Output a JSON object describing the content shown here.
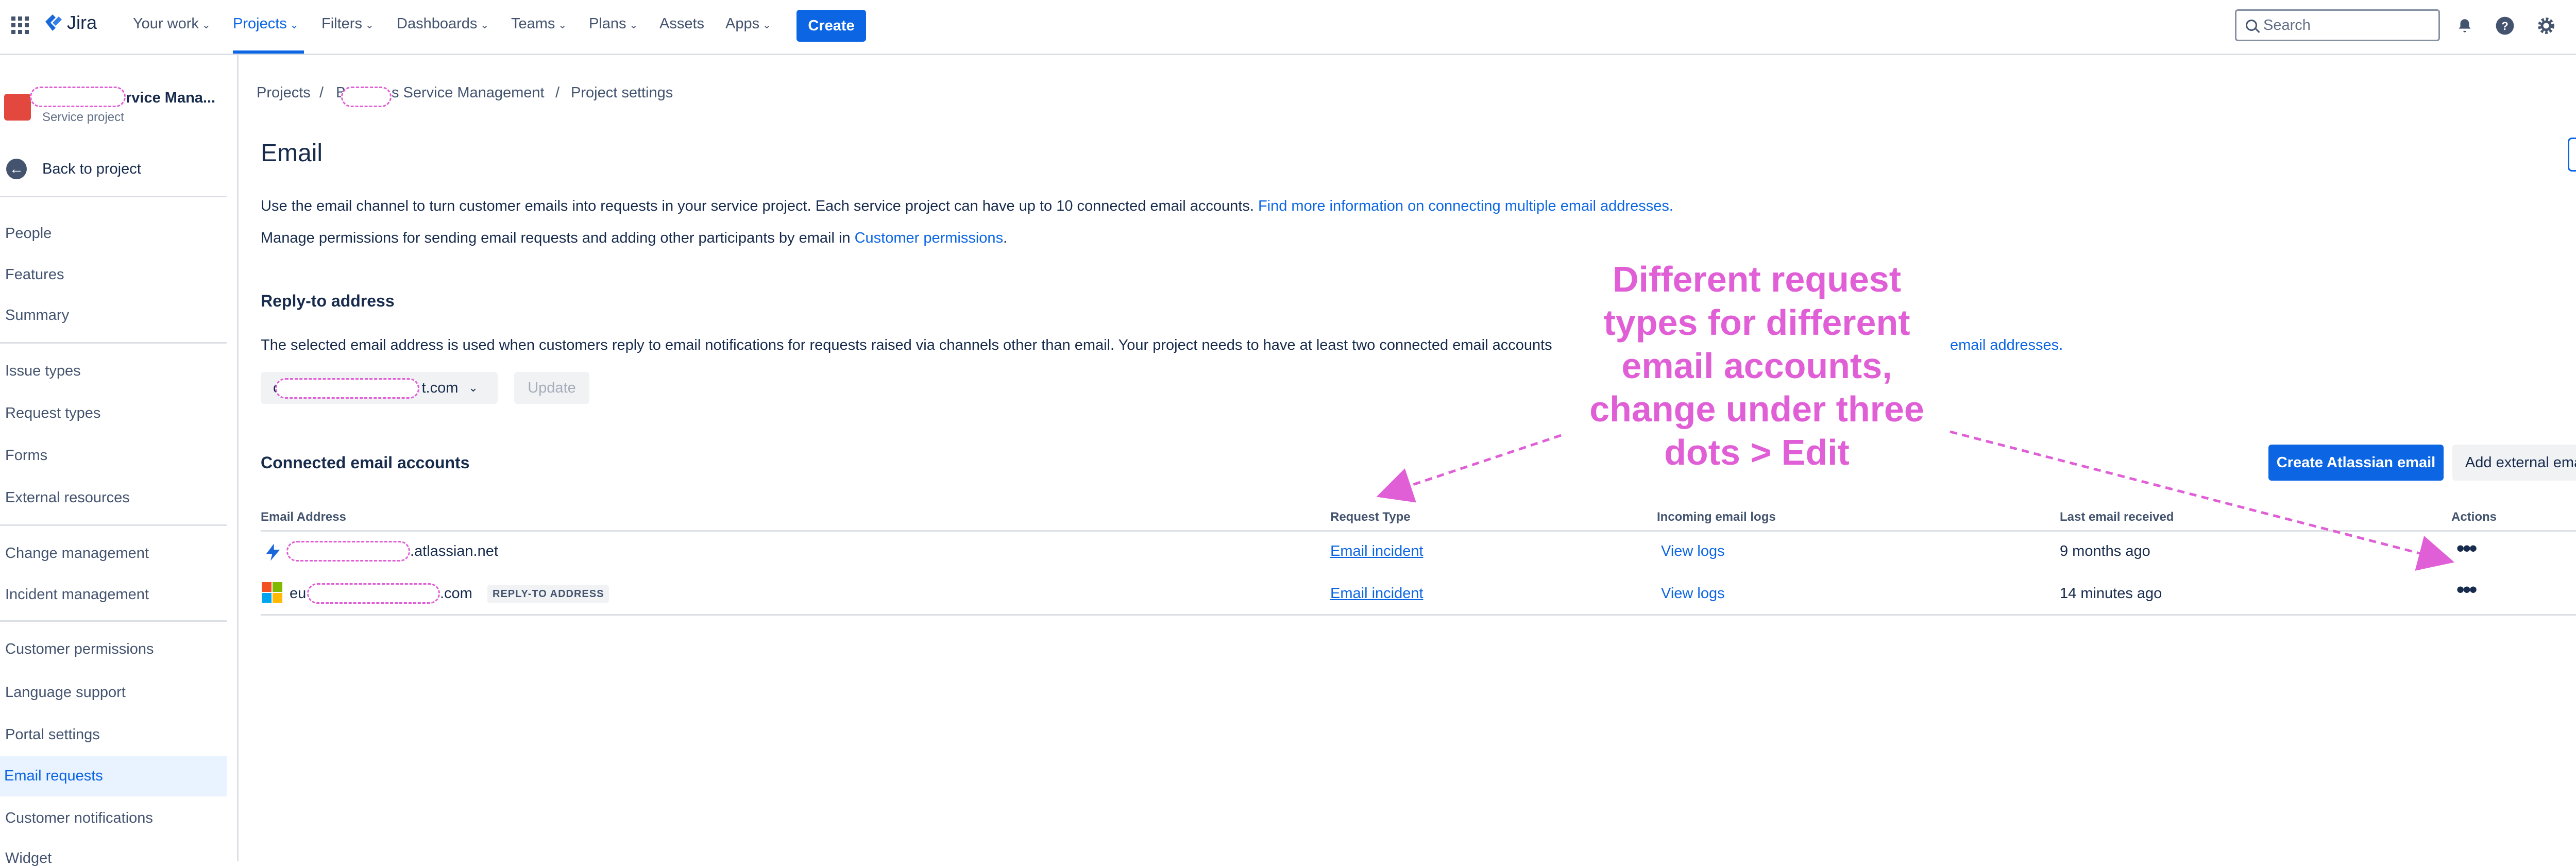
{
  "topnav": {
    "app_name": "Jira",
    "items": [
      {
        "label": "Your work"
      },
      {
        "label": "Projects"
      },
      {
        "label": "Filters"
      },
      {
        "label": "Dashboards"
      },
      {
        "label": "Teams"
      },
      {
        "label": "Plans"
      },
      {
        "label": "Assets"
      },
      {
        "label": "Apps"
      }
    ],
    "active_item": "Projects",
    "create_label": "Create",
    "search_placeholder": "Search"
  },
  "sidebar": {
    "project_name": "rvice Mana...",
    "project_type": "Service project",
    "back_label": "Back to project",
    "items": [
      {
        "label": "People"
      },
      {
        "label": "Features"
      },
      {
        "label": "Summary"
      },
      {
        "label": "Issue types"
      },
      {
        "label": "Request types"
      },
      {
        "label": "Forms"
      },
      {
        "label": "External resources"
      },
      {
        "label": "Change management"
      },
      {
        "label": "Incident management"
      },
      {
        "label": "Customer permissions"
      },
      {
        "label": "Language support"
      },
      {
        "label": "Portal settings"
      },
      {
        "label": "Email requests"
      },
      {
        "label": "Customer notifications"
      },
      {
        "label": "Widget"
      }
    ],
    "selected_item": "Email requests"
  },
  "breadcrumb": {
    "items": [
      "Projects",
      "B",
      "s Service Management",
      "Project settings"
    ],
    "separator": "/"
  },
  "main": {
    "title": "Email",
    "intro_text": "Use the email channel to turn customer emails into requests in your service project. Each service project can have up to 10 connected email accounts.",
    "intro_link": "Find more information on connecting multiple email addresses.",
    "permissions_text": "Manage permissions for sending email requests and adding other participants by email in",
    "permissions_link": "Customer permissions",
    "permissions_suffix": ".",
    "reply_to": {
      "title": "Reply-to address",
      "text": "The selected email address is used when customers reply to email notifications for requests raised via channels other than email. Your project needs to have at least two connected email accounts",
      "link": "email addresses.",
      "selected_prefix": "c",
      "selected_suffix": "t.com",
      "update_label": "Update"
    },
    "connected": {
      "title": "Connected email accounts",
      "create_atlassian_label": "Create Atlassian email",
      "add_external_label": "Add external email",
      "columns": [
        "Email Address",
        "Request Type",
        "Incoming email logs",
        "Last email received",
        "Actions"
      ],
      "rows": [
        {
          "email_prefix": "",
          "email_suffix": ".atlassian.net",
          "request_type": "Email incident",
          "logs": "View logs",
          "last_received": "9 months ago",
          "badge": ""
        },
        {
          "email_prefix": "eu",
          "email_suffix": ".com",
          "request_type": "Email incident",
          "logs": "View logs",
          "last_received": "14 minutes ago",
          "badge": "REPLY-TO ADDRESS"
        }
      ]
    }
  },
  "annotation": {
    "text_lines": [
      "Different request",
      "types for different",
      "email accounts,",
      "change under three",
      "dots > Edit"
    ],
    "color": "#e05fd6"
  },
  "colors": {
    "accent": "#0c66e4",
    "text": "#172b4d",
    "annotation": "#e05fd6"
  }
}
